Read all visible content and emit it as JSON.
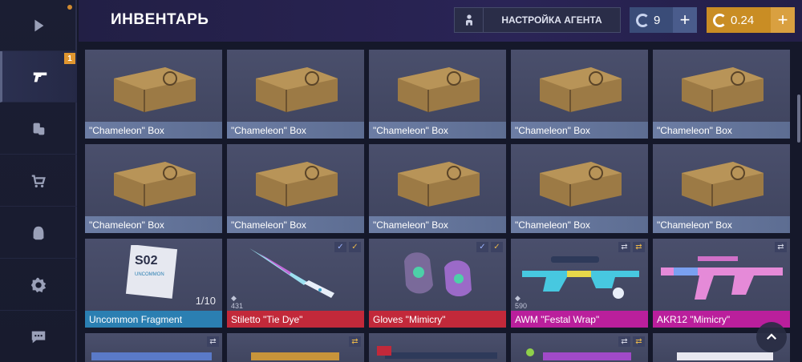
{
  "header": {
    "title": "ИНВЕНТАРЬ",
    "agent_settings_label": "НАСТРОЙКА АГЕНТА",
    "silver_value": "9",
    "gold_value": "0.24"
  },
  "sidebar": {
    "inventory_badge": "1"
  },
  "items": [
    {
      "name": "\"Chameleon\" Box"
    },
    {
      "name": "\"Chameleon\" Box"
    },
    {
      "name": "\"Chameleon\" Box"
    },
    {
      "name": "\"Chameleon\" Box"
    },
    {
      "name": "\"Chameleon\" Box"
    },
    {
      "name": "\"Chameleon\" Box"
    },
    {
      "name": "\"Chameleon\" Box"
    },
    {
      "name": "\"Chameleon\" Box"
    },
    {
      "name": "\"Chameleon\" Box"
    },
    {
      "name": "\"Chameleon\" Box"
    },
    {
      "name": "Uncommon Fragment",
      "count": "1/10",
      "season": "S02",
      "tag": "UNCOMMON"
    },
    {
      "name": "Stiletto \"Tie Dye\"",
      "owned": "431"
    },
    {
      "name": "Gloves \"Mimicry\""
    },
    {
      "name": "AWM \"Festal Wrap\"",
      "owned": "590"
    },
    {
      "name": "AKR12 \"Mimicry\""
    }
  ],
  "colors": {
    "common": "#6c7da4",
    "uncommon": "#2b7fb2",
    "rare_red": "#c2293a",
    "pink": "#ba1f9c",
    "gold": "#c98d24",
    "silver": "#3a4c78"
  }
}
